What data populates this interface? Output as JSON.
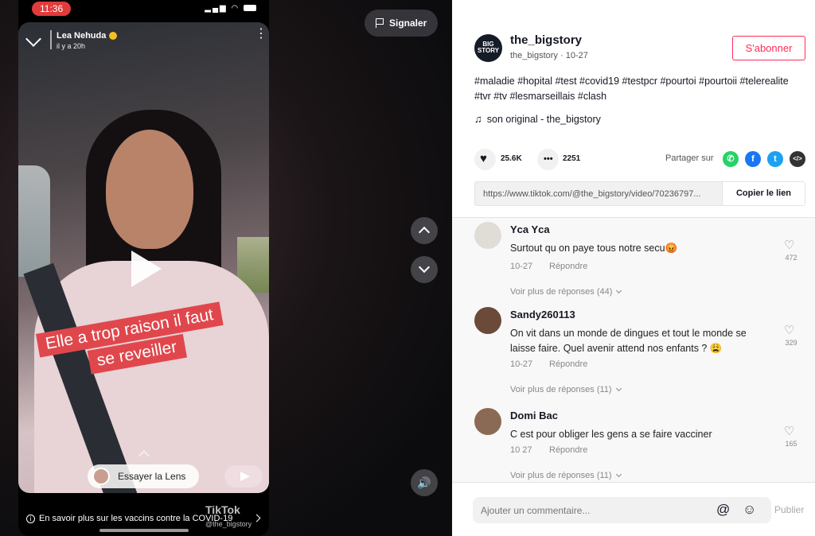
{
  "status_bar": {
    "time": "11:36"
  },
  "video": {
    "creator_name": "Lea Nehuda",
    "creator_time": "il y a 20h",
    "caption_line1": "Elle a trop raison il faut",
    "caption_line2": "se reveiller",
    "lens_label": "Essayer la Lens",
    "covid_banner": "En savoir plus sur les vaccins contre la COVID-19",
    "watermark": "TikTok",
    "watermark_handle": "@the_bigstory",
    "report_label": "Signaler"
  },
  "author": {
    "avatar_text_line1": "BIG",
    "avatar_text_line2": "STORY",
    "username": "the_bigstory",
    "sub": "the_bigstory · 10-27",
    "subscribe_label": "S'abonner"
  },
  "description": {
    "hashtags": "#maladie #hopital #test #covid19 #testpcr #pourtoi #pourtoii #telerealite #tvr #tv #lesmarseillais #clash",
    "sound": "son original - the_bigstory"
  },
  "stats": {
    "likes": "25.6K",
    "comments": "2251",
    "share_label": "Partager sur"
  },
  "link": {
    "url": "https://www.tiktok.com/@the_bigstory/video/70236797...",
    "copy_label": "Copier le lien"
  },
  "comments": [
    {
      "user": "Yca Yca",
      "text": "Surtout qu on paye tous notre secu😡",
      "date": "10-27",
      "reply": "Répondre",
      "likes": "472",
      "more": "Voir plus de réponses (44)"
    },
    {
      "user": "Sandy260113",
      "text": "On vit dans un monde de dingues et tout le monde se laisse faire. Quel avenir attend nos enfants ? 😩",
      "date": "10-27",
      "reply": "Répondre",
      "likes": "329",
      "more": "Voir plus de réponses (11)"
    },
    {
      "user": "Domi Bac",
      "text": "C est pour obliger les gens a se faire vacciner",
      "date": "10 27",
      "reply": "Répondre",
      "likes": "165",
      "more": "Voir plus de réponses (11)"
    }
  ],
  "comment_bar": {
    "placeholder": "Ajouter un commentaire...",
    "publish_label": "Publier"
  },
  "colors": {
    "accent": "#fe2c55",
    "caption_bg": "#e0474c"
  },
  "icons": [
    "chevron-down-icon",
    "verified-icon",
    "more-icon",
    "play-icon",
    "send-icon",
    "info-icon",
    "flag-icon",
    "chevron-up-icon",
    "volume-icon",
    "music-icon",
    "heart-icon",
    "comment-icon",
    "whatsapp-icon",
    "facebook-icon",
    "twitter-icon",
    "embed-icon",
    "mention-icon",
    "emoji-icon"
  ]
}
